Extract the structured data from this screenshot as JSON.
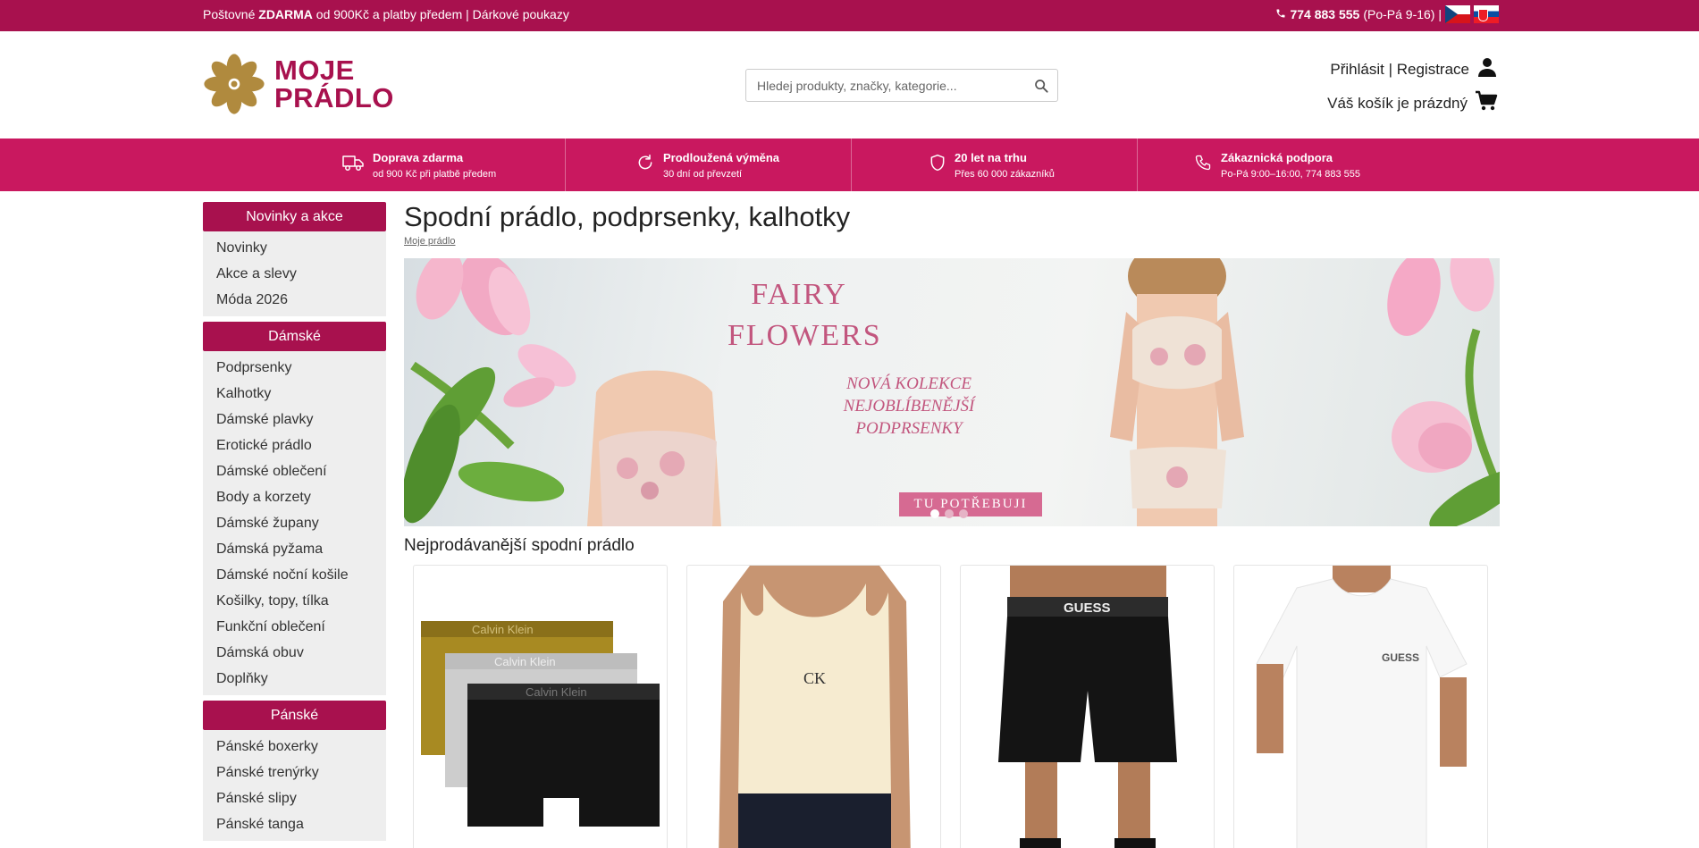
{
  "topbar": {
    "promo_prefix": "Poštovné ",
    "promo_bold": "ZDARMA",
    "promo_suffix": " od 900Kč a platby předem | Dárkové poukazy",
    "phone": "774 883 555",
    "hours": " (Po-Pá 9-16) |"
  },
  "header": {
    "logo_line1": "MOJE",
    "logo_line2": "PRÁDLO",
    "search_placeholder": "Hledej produkty, značky, kategorie...",
    "account_text": "Přihlásit | Registrace",
    "cart_text": "Váš košík je prázdný"
  },
  "benefits": [
    {
      "title": "Doprava zdarma",
      "subtitle": "od 900 Kč při platbě předem",
      "icon": "truck-icon"
    },
    {
      "title": "Prodloužená výměna",
      "subtitle": "30 dní od převzetí",
      "icon": "refresh-icon"
    },
    {
      "title": "20 let na trhu",
      "subtitle": "Přes 60 000 zákazníků",
      "icon": "shield-icon"
    },
    {
      "title": "Zákaznická podpora",
      "subtitle": "Po-Pá 9:00–16:00, 774 883 555",
      "icon": "phone-icon"
    }
  ],
  "sidebar": {
    "sections": [
      {
        "title": "Novinky a akce",
        "items": [
          "Novinky",
          "Akce a slevy",
          "Móda 2026"
        ]
      },
      {
        "title": "Dámské",
        "items": [
          "Podprsenky",
          "Kalhotky",
          "Dámské plavky",
          "Erotické prádlo",
          "Dámské oblečení",
          "Body a korzety",
          "Dámské župany",
          "Dámská pyžama",
          "Dámské noční košile",
          "Košilky, topy, tílka",
          "Funkční oblečení",
          "Dámská obuv",
          "Doplňky"
        ]
      },
      {
        "title": "Pánské",
        "items": [
          "Pánské boxerky",
          "Pánské trenýrky",
          "Pánské slipy",
          "Pánské tanga"
        ]
      }
    ]
  },
  "main": {
    "title": "Spodní prádlo, podprsenky, kalhotky",
    "breadcrumb": "Moje prádlo",
    "banner": {
      "line1": "FAIRY",
      "line2": "FLOWERS",
      "sub1": "NOVÁ KOLEKCE",
      "sub2": "NEJOBLÍBENĚJŠÍ",
      "sub3": "PODPRSENKY",
      "cta": "TU POTŘEBUJI"
    },
    "section_title": "Nejprodávanější spodní prádlo",
    "products": [
      {
        "brand_text": "Calvin Klein",
        "kind": "boxers-3pack"
      },
      {
        "brand_text": "CK",
        "kind": "tank-top"
      },
      {
        "brand_text": "GUESS",
        "kind": "shorts"
      },
      {
        "brand_text": "GUESS",
        "kind": "tshirt"
      }
    ]
  },
  "colors": {
    "brand": "#a8114e",
    "benefits_bar": "#c9185f",
    "logo_gold": "#b08a3e"
  }
}
